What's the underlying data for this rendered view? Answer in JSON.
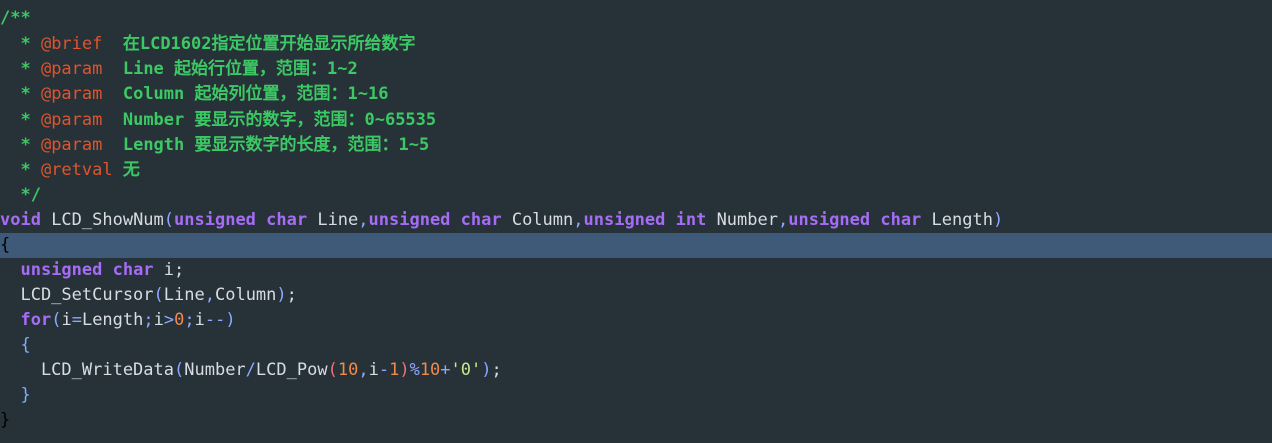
{
  "editor": {
    "lines": [
      [
        {
          "t": "/**",
          "c": "comment"
        }
      ],
      [
        {
          "t": "  * ",
          "c": "comment"
        },
        {
          "t": "@brief  ",
          "c": "doctag"
        },
        {
          "t": "在LCD1602指定位置开始显示所给数字",
          "c": "comment"
        }
      ],
      [
        {
          "t": "  * ",
          "c": "comment"
        },
        {
          "t": "@param  ",
          "c": "doctag"
        },
        {
          "t": "Line 起始行位置，范围：1~2",
          "c": "comment"
        }
      ],
      [
        {
          "t": "  * ",
          "c": "comment"
        },
        {
          "t": "@param  ",
          "c": "doctag"
        },
        {
          "t": "Column 起始列位置，范围：1~16",
          "c": "comment"
        }
      ],
      [
        {
          "t": "  * ",
          "c": "comment"
        },
        {
          "t": "@param  ",
          "c": "doctag"
        },
        {
          "t": "Number 要显示的数字，范围：0~65535",
          "c": "comment"
        }
      ],
      [
        {
          "t": "  * ",
          "c": "comment"
        },
        {
          "t": "@param  ",
          "c": "doctag"
        },
        {
          "t": "Length 要显示数字的长度，范围：1~5",
          "c": "comment"
        }
      ],
      [
        {
          "t": "  * ",
          "c": "comment"
        },
        {
          "t": "@retval ",
          "c": "doctag"
        },
        {
          "t": "无",
          "c": "comment"
        }
      ],
      [
        {
          "t": "  */",
          "c": "comment"
        }
      ],
      [
        {
          "t": "void",
          "c": "keyword"
        },
        {
          "t": " LCD_ShowNum",
          "c": "ident"
        },
        {
          "t": "(",
          "c": "punct"
        },
        {
          "t": "unsigned char",
          "c": "keyword"
        },
        {
          "t": " Line",
          "c": "ident"
        },
        {
          "t": ",",
          "c": "punct"
        },
        {
          "t": "unsigned char",
          "c": "keyword"
        },
        {
          "t": " Column",
          "c": "ident"
        },
        {
          "t": ",",
          "c": "punct"
        },
        {
          "t": "unsigned int",
          "c": "keyword"
        },
        {
          "t": " Number",
          "c": "ident"
        },
        {
          "t": ",",
          "c": "punct"
        },
        {
          "t": "unsigned char",
          "c": "keyword"
        },
        {
          "t": " Length",
          "c": "ident"
        },
        {
          "t": ")",
          "c": "punct"
        }
      ],
      [
        {
          "t": "{",
          "c": "caret-brace"
        }
      ],
      [
        {
          "t": "  ",
          "c": "ident"
        },
        {
          "t": "unsigned char",
          "c": "keyword"
        },
        {
          "t": " i;",
          "c": "ident"
        }
      ],
      [
        {
          "t": "  LCD_SetCursor",
          "c": "ident"
        },
        {
          "t": "(",
          "c": "punct"
        },
        {
          "t": "Line",
          "c": "ident"
        },
        {
          "t": ",",
          "c": "punct"
        },
        {
          "t": "Column",
          "c": "ident"
        },
        {
          "t": ")",
          "c": "punct"
        },
        {
          "t": ";",
          "c": "ident"
        }
      ],
      [
        {
          "t": "  ",
          "c": "ident"
        },
        {
          "t": "for",
          "c": "keyword"
        },
        {
          "t": "(",
          "c": "punct"
        },
        {
          "t": "i",
          "c": "ident"
        },
        {
          "t": "=",
          "c": "punct"
        },
        {
          "t": "Length",
          "c": "ident"
        },
        {
          "t": ";",
          "c": "punct"
        },
        {
          "t": "i",
          "c": "ident"
        },
        {
          "t": ">",
          "c": "punct"
        },
        {
          "t": "0",
          "c": "number"
        },
        {
          "t": ";",
          "c": "punct"
        },
        {
          "t": "i",
          "c": "ident"
        },
        {
          "t": "--",
          "c": "punct"
        },
        {
          "t": ")",
          "c": "punct"
        }
      ],
      [
        {
          "t": "  ",
          "c": "ident"
        },
        {
          "t": "{",
          "c": "brace"
        }
      ],
      [
        {
          "t": "    LCD_WriteData",
          "c": "ident"
        },
        {
          "t": "(",
          "c": "punct"
        },
        {
          "t": "Number",
          "c": "ident"
        },
        {
          "t": "/",
          "c": "punct"
        },
        {
          "t": "LCD_Pow",
          "c": "ident"
        },
        {
          "t": "(",
          "c": "op"
        },
        {
          "t": "10",
          "c": "number"
        },
        {
          "t": ",",
          "c": "punct"
        },
        {
          "t": "i",
          "c": "ident"
        },
        {
          "t": "-",
          "c": "punct"
        },
        {
          "t": "1",
          "c": "number"
        },
        {
          "t": ")",
          "c": "op"
        },
        {
          "t": "%",
          "c": "punct"
        },
        {
          "t": "10",
          "c": "number"
        },
        {
          "t": "+",
          "c": "punct"
        },
        {
          "t": "'0'",
          "c": "string"
        },
        {
          "t": ")",
          "c": "punct"
        },
        {
          "t": ";",
          "c": "ident"
        }
      ],
      [
        {
          "t": "  ",
          "c": "ident"
        },
        {
          "t": "}",
          "c": "brace"
        }
      ],
      [
        {
          "t": "}",
          "c": "caret-brace"
        }
      ]
    ],
    "highlighted_line": 9
  }
}
